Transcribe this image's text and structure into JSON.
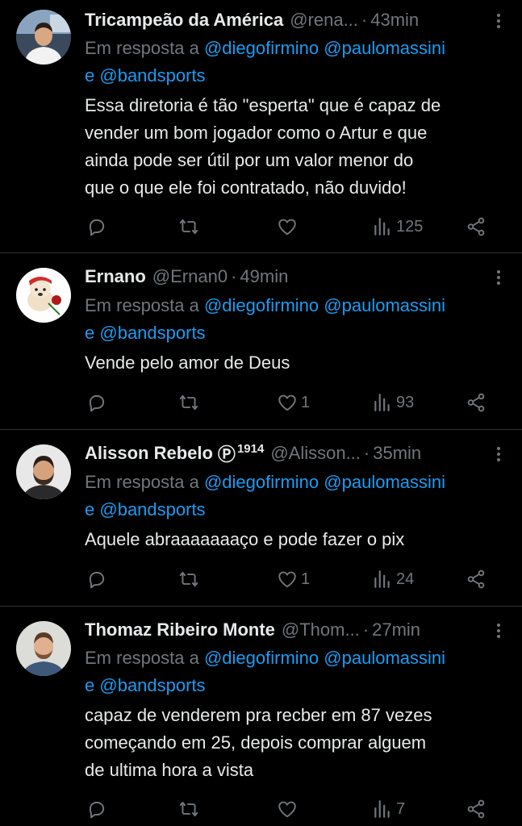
{
  "colors": {
    "background": "#000000",
    "text": "#e7e9ea",
    "secondary": "#71767b",
    "link": "#1d9bf0",
    "separator": "#2f3336"
  },
  "reply_prefix": "Em resposta a",
  "reply_connector": "e",
  "tweets": [
    {
      "name": "Tricampeão da América",
      "handle": "@rena...",
      "time": "43min",
      "mentions": [
        "@diegofirmino",
        "@paulomassini",
        "@bandsports"
      ],
      "body": [
        "Essa diretoria é tão \"esperta\" que é capaz de",
        "vender um bom jogador como o Artur e que",
        "ainda pode ser útil por um valor menor do",
        "que o que ele foi contratado, não duvido!"
      ],
      "likes": "",
      "views": "125",
      "avatar_icon": "man-in-car-avatar"
    },
    {
      "name": "Ernano",
      "handle": "@Ernan0",
      "time": "49min",
      "mentions": [
        "@diegofirmino",
        "@paulomassini",
        "@bandsports"
      ],
      "body": [
        "Vende pelo amor de Deus"
      ],
      "likes": "1",
      "views": "93",
      "avatar_icon": "dog-with-rose-avatar"
    },
    {
      "name": "Alisson Rebelo",
      "badge": "Ⓟ",
      "badge_num": "1914",
      "handle": "@Alisson...",
      "time": "35min",
      "mentions": [
        "@diegofirmino",
        "@paulomassini",
        "@bandsports"
      ],
      "body": [
        "Aquele abraaaaaaaço e pode fazer o pix"
      ],
      "likes": "1",
      "views": "24",
      "avatar_icon": "bearded-man-avatar"
    },
    {
      "name": "Thomaz Ribeiro Monte",
      "handle": "@Thom...",
      "time": "27min",
      "mentions": [
        "@diegofirmino",
        "@paulomassini",
        "@bandsports"
      ],
      "body": [
        "capaz de venderem pra recber em 87 vezes",
        "começando em 25, depois comprar alguem",
        "de ultima hora a vista"
      ],
      "likes": "",
      "views": "7",
      "avatar_icon": "man-avatar"
    }
  ]
}
